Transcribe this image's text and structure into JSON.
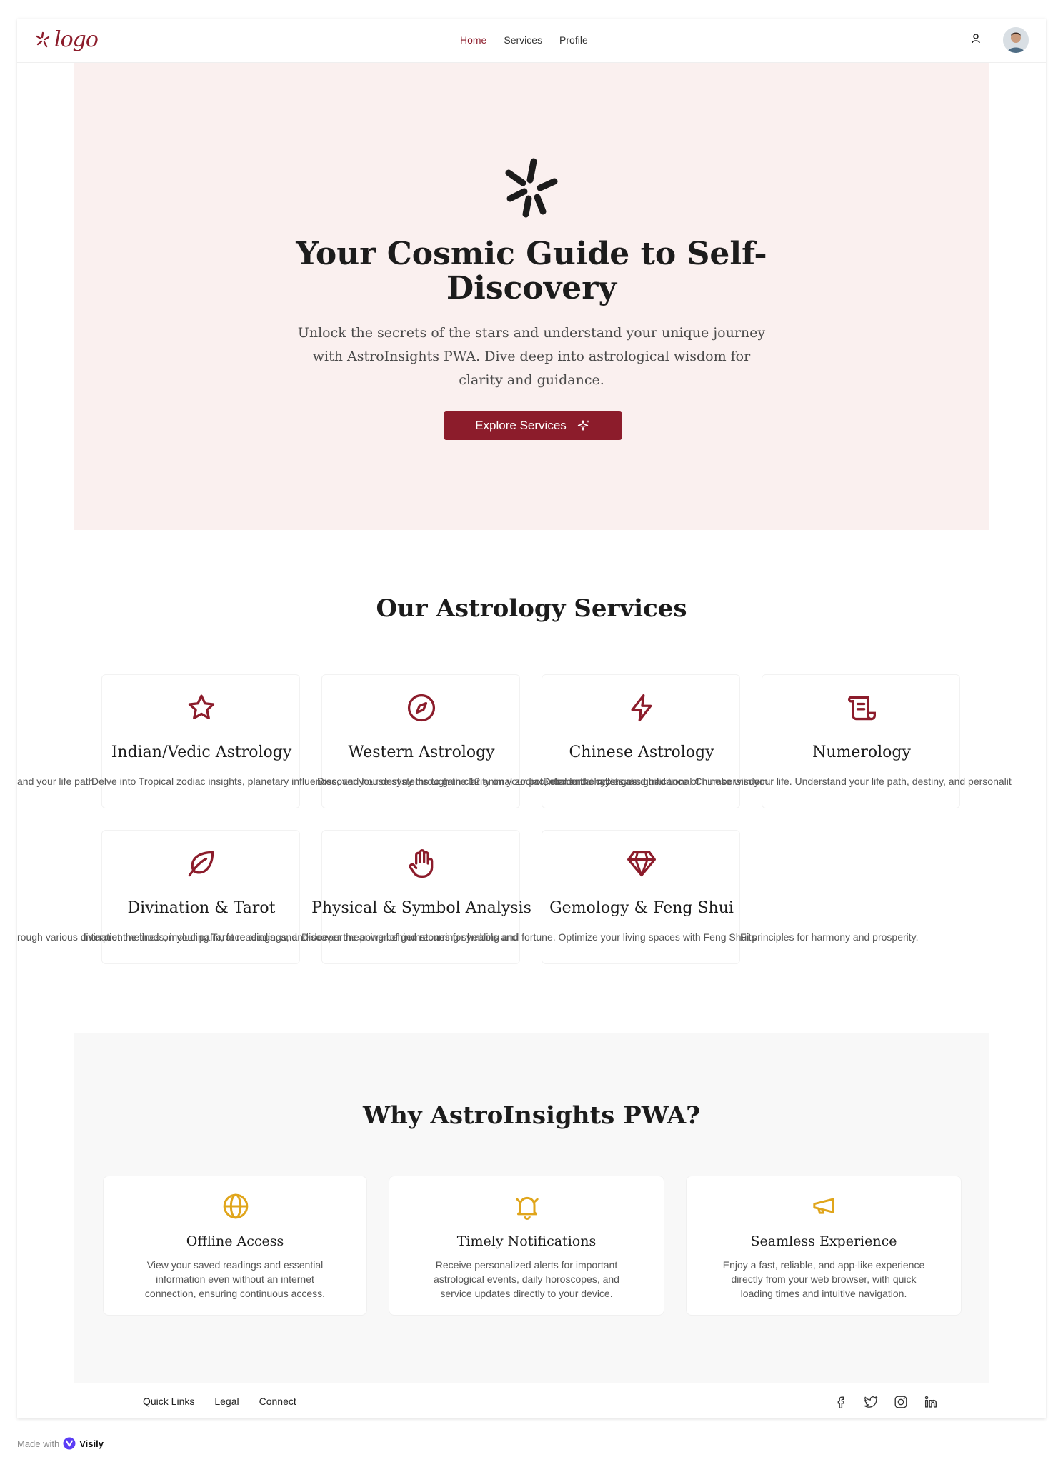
{
  "header": {
    "logo_text": "logo",
    "nav": [
      "Home",
      "Services",
      "Profile"
    ],
    "active_nav": "Home",
    "icons": [
      "user-icon",
      "avatar"
    ]
  },
  "hero": {
    "title": "Your Cosmic Guide to Self-Discovery",
    "subtitle": "Unlock the secrets of the stars and understand your unique journey with AstroInsights PWA. Dive deep into astrological wisdom for clarity and guidance.",
    "cta_label": "Explore Services",
    "icon": "asterisk-icon"
  },
  "services": {
    "title": "Our Astrology Services",
    "items": [
      {
        "title": "Indian/Vedic Astrology",
        "icon": "star-icon"
      },
      {
        "title": "Western Astrology",
        "icon": "compass-icon"
      },
      {
        "title": "Chinese Astrology",
        "icon": "lightning-icon"
      },
      {
        "title": "Numerology",
        "icon": "scroll-icon"
      },
      {
        "title": "Divination & Tarot",
        "icon": "leaf-icon"
      },
      {
        "title": "Physical & Symbol Analysis",
        "icon": "hand-icon"
      },
      {
        "title": "Gemology & Feng Shui",
        "icon": "gem-icon"
      }
    ],
    "row1_desc_fragments": [
      "and your life path.",
      "Delve into Tropical zodiac insights, planetary influences, and house systems to gain clarity on your potential and challenges.",
      "Discover your destiny through the 12 animal zodiac, elemental cycles, and traditional Chinese wisdom.",
      "Decode the mystical significance of numbers in your life. Understand your life path, destiny, and personalit"
    ],
    "row2_desc_fragments": [
      "rough various divination methods, including Tarot readings, and",
      "Interpret the lines on your palm, face readings, and deeper meaning behind recurring symbols and",
      "Discover the power of gemstones for healing and fortune. Optimize your living spaces with Feng Shui principles for harmony and prosperity.",
      "Fits"
    ]
  },
  "why": {
    "title": "Why AstroInsights PWA?",
    "items": [
      {
        "title": "Offline Access",
        "desc": "View your saved readings and essential information even without an internet connection, ensuring continuous access.",
        "icon": "globe-icon"
      },
      {
        "title": "Timely Notifications",
        "desc": "Receive personalized alerts for important astrological events, daily horoscopes, and service updates directly to your device.",
        "icon": "bell-icon"
      },
      {
        "title": "Seamless Experience",
        "desc": "Enjoy a fast, reliable, and app-like experience directly from your web browser, with quick loading times and intuitive navigation.",
        "icon": "megaphone-icon"
      }
    ]
  },
  "footer": {
    "links": [
      "Quick Links",
      "Legal",
      "Connect"
    ],
    "social": [
      "facebook-icon",
      "twitter-icon",
      "instagram-icon",
      "linkedin-icon"
    ]
  },
  "madewith": {
    "prefix": "Made with",
    "brand": "Visily"
  },
  "colors": {
    "accent": "#8c1c2b",
    "hero_bg": "#faf0ef",
    "why_icon": "#e0a51b",
    "why_bg": "#f8f8f8"
  }
}
